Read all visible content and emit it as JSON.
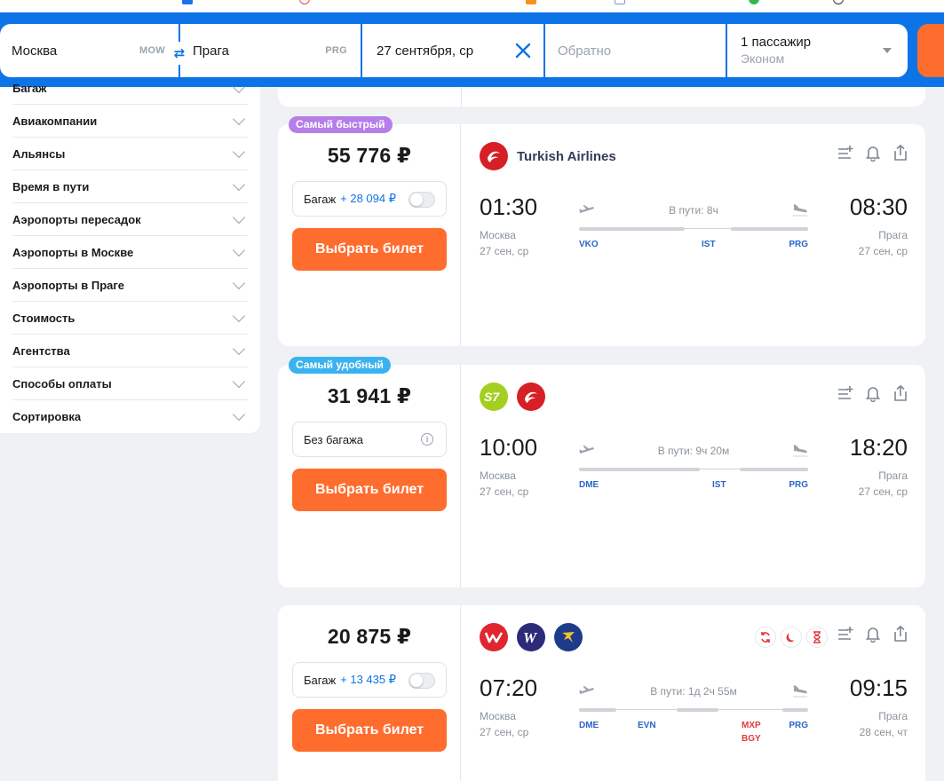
{
  "search": {
    "from_city": "Москва",
    "from_code": "MOW",
    "to_city": "Прага",
    "to_code": "PRG",
    "date": "27 сентября, ср",
    "return_placeholder": "Обратно",
    "passengers": "1 пассажир",
    "cabin": "Эконом"
  },
  "filters": [
    "Багаж",
    "Авиакомпании",
    "Альянсы",
    "Время в пути",
    "Аэропорты пересадок",
    "Аэропорты в Москве",
    "Аэропорты в Праге",
    "Стоимость",
    "Агентства",
    "Способы оплаты",
    "Сортировка"
  ],
  "buy_label": "Выбрать билет",
  "tickets": [
    {
      "badge": "Самый быстрый",
      "badge_color": "#b57ee8",
      "price": "55 776 ₽",
      "bag_label": "Багаж",
      "bag_extra": "+ 28 094 ₽",
      "airline_name": "Turkish Airlines",
      "dep_time": "01:30",
      "arr_time": "08:30",
      "dep_city": "Москва",
      "arr_city": "Прага",
      "dep_date": "27 сен, ср",
      "arr_date": "27 сен, ср",
      "duration": "В пути: 8ч",
      "stops": [
        "VKO",
        "IST",
        "PRG"
      ]
    },
    {
      "badge": "Самый удобный",
      "badge_color": "#3bb2f0",
      "price": "31 941 ₽",
      "bag_label": "Без багажа",
      "dep_time": "10:00",
      "arr_time": "18:20",
      "dep_city": "Москва",
      "arr_city": "Прага",
      "dep_date": "27 сен, ср",
      "arr_date": "27 сен, ср",
      "duration": "В пути: 9ч 20м",
      "stops": [
        "DME",
        "IST",
        "PRG"
      ]
    },
    {
      "price": "20 875 ₽",
      "bag_label": "Багаж",
      "bag_extra": "+ 13 435 ₽",
      "dep_time": "07:20",
      "arr_time": "09:15",
      "dep_city": "Москва",
      "arr_city": "Прага",
      "dep_date": "27 сен, ср",
      "arr_date": "28 сен, чт",
      "duration": "В пути: 1д 2ч 55м",
      "stops": [
        "DME",
        "EVN",
        "MXP",
        "BGY",
        "PRG"
      ]
    }
  ],
  "colors": {
    "brand_blue": "#0d74e7",
    "cta_orange": "#ff6d2e"
  }
}
